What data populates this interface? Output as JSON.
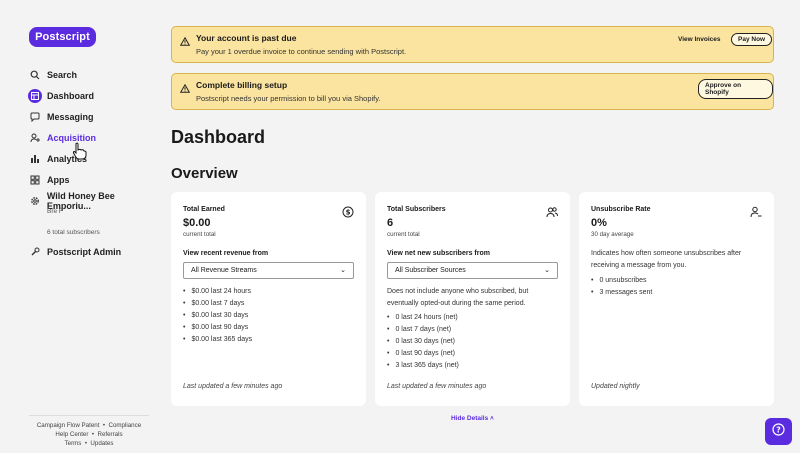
{
  "brand": {
    "logo_text": "Postscript",
    "accent": "#5b2be0"
  },
  "sidebar": {
    "items": [
      {
        "label": "Search",
        "icon": "search-icon"
      },
      {
        "label": "Dashboard",
        "icon": "dashboard-icon"
      },
      {
        "label": "Messaging",
        "icon": "chat-icon"
      },
      {
        "label": "Acquisition",
        "icon": "acquisition-icon"
      },
      {
        "label": "Analytics",
        "icon": "bar-chart-icon"
      },
      {
        "label": "Apps",
        "icon": "apps-grid-icon"
      },
      {
        "label": "Wild Honey Bee Emporiu...",
        "icon": "gear-icon"
      },
      {
        "label": "Postscript Admin",
        "icon": "wrench-icon"
      }
    ],
    "shop_user": "Bre F",
    "subscriber_count": "6 total subscribers",
    "footer": {
      "line1": [
        "Campaign Flow Patent",
        "Compliance"
      ],
      "line2": [
        "Help Center",
        "Referrals"
      ],
      "line3": [
        "Terms",
        "Updates"
      ]
    }
  },
  "banners": [
    {
      "title": "Your account is past due",
      "text": "Pay your 1 overdue invoice to continue sending with Postscript.",
      "link": "View Invoices",
      "button": "Pay Now"
    },
    {
      "title": "Complete billing setup",
      "text": "Postscript needs your permission to bill you via Shopify.",
      "button": "Approve on Shopify"
    }
  ],
  "page": {
    "title": "Dashboard",
    "section": "Overview"
  },
  "cards": [
    {
      "title": "Total Earned",
      "value": "$0.00",
      "sub": "current total",
      "icon": "dollar-circle-icon",
      "select_label": "View recent revenue from",
      "select_value": "All Revenue Streams",
      "list": [
        "$0.00 last 24 hours",
        "$0.00 last 7 days",
        "$0.00 last 30 days",
        "$0.00 last 90 days",
        "$0.00 last 365 days"
      ],
      "updated": "Last updated a few minutes ago"
    },
    {
      "title": "Total Subscribers",
      "value": "6",
      "sub": "current total",
      "icon": "users-icon",
      "select_label": "View net new subscribers from",
      "select_value": "All Subscriber Sources",
      "description": "Does not include anyone who subscribed, but eventually opted-out during the same period.",
      "list": [
        "0 last 24 hours (net)",
        "0 last 7 days (net)",
        "0 last 30 days (net)",
        "0 last 90 days (net)",
        "3 last 365 days (net)"
      ],
      "updated": "Last updated a few minutes ago"
    },
    {
      "title": "Unsubscribe Rate",
      "value": "0%",
      "sub": "30 day average",
      "icon": "user-minus-icon",
      "description": "Indicates how often someone unsubscribes after receiving a message from you.",
      "list": [
        "0 unsubscribes",
        "3 messages sent"
      ],
      "updated": "Updated nightly"
    }
  ],
  "hide_details": "Hide Details"
}
